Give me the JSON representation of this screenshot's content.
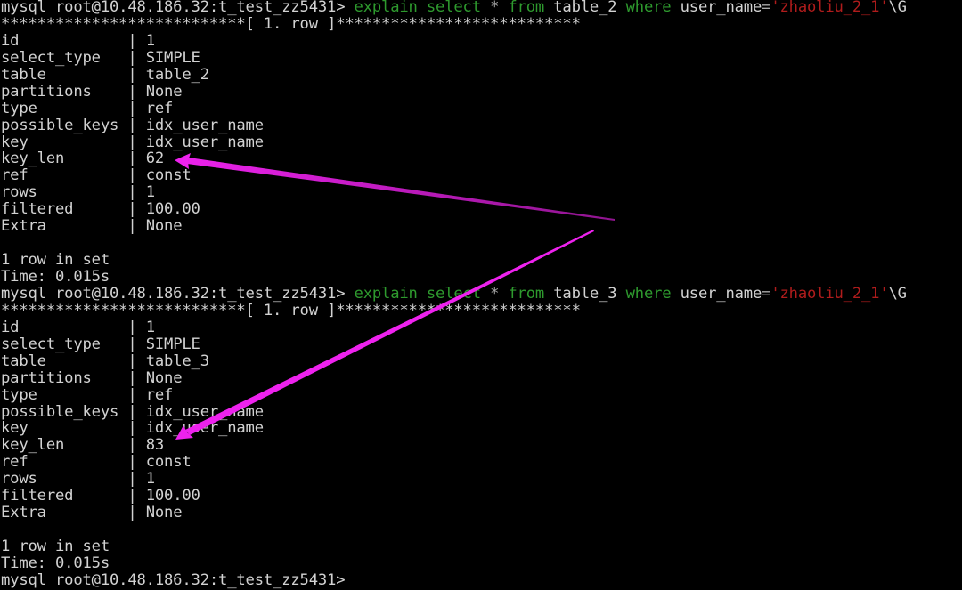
{
  "terminal": {
    "prompt": "mysql root@10.48.186.32:t_test_zz5431>",
    "colors": {
      "background": "#000000",
      "text": "#d2d2d2",
      "keyword": "#2e9a2e",
      "string": "#b01c1c",
      "annotation_arrow": "#ee22ee"
    },
    "queries": [
      {
        "command": {
          "kw1": "explain select",
          "star": "*",
          "kw2": "from",
          "table": "table_2",
          "kw3": "where",
          "column": "user_name=",
          "value": "'zhaoliu_2_1'",
          "terminator": "\\G"
        },
        "row_header": "***************************[ 1. row ]***************************",
        "fields": [
          {
            "name": "id",
            "value": "1"
          },
          {
            "name": "select_type",
            "value": "SIMPLE"
          },
          {
            "name": "table",
            "value": "table_2"
          },
          {
            "name": "partitions",
            "value": "None"
          },
          {
            "name": "type",
            "value": "ref"
          },
          {
            "name": "possible_keys",
            "value": "idx_user_name"
          },
          {
            "name": "key",
            "value": "idx_user_name"
          },
          {
            "name": "key_len",
            "value": "62"
          },
          {
            "name": "ref",
            "value": "const"
          },
          {
            "name": "rows",
            "value": "1"
          },
          {
            "name": "filtered",
            "value": "100.00"
          },
          {
            "name": "Extra",
            "value": "None"
          }
        ],
        "summary": "1 row in set",
        "time": "Time: 0.015s"
      },
      {
        "command": {
          "kw1": "explain select",
          "star": "*",
          "kw2": "from",
          "table": "table_3",
          "kw3": "where",
          "column": "user_name=",
          "value": "'zhaoliu_2_1'",
          "terminator": "\\G"
        },
        "row_header": "***************************[ 1. row ]***************************",
        "fields": [
          {
            "name": "id",
            "value": "1"
          },
          {
            "name": "select_type",
            "value": "SIMPLE"
          },
          {
            "name": "table",
            "value": "table_3"
          },
          {
            "name": "partitions",
            "value": "None"
          },
          {
            "name": "type",
            "value": "ref"
          },
          {
            "name": "possible_keys",
            "value": "idx_user_name"
          },
          {
            "name": "key",
            "value": "idx_user_name"
          },
          {
            "name": "key_len",
            "value": "83"
          },
          {
            "name": "ref",
            "value": "const"
          },
          {
            "name": "rows",
            "value": "1"
          },
          {
            "name": "filtered",
            "value": "100.00"
          },
          {
            "name": "Extra",
            "value": "None"
          }
        ],
        "summary": "1 row in set",
        "time": "Time: 0.015s"
      }
    ],
    "annotations": [
      {
        "type": "arrow-icon",
        "points_to": "key_len 62"
      },
      {
        "type": "arrow-icon",
        "points_to": "key_len 83"
      }
    ]
  }
}
